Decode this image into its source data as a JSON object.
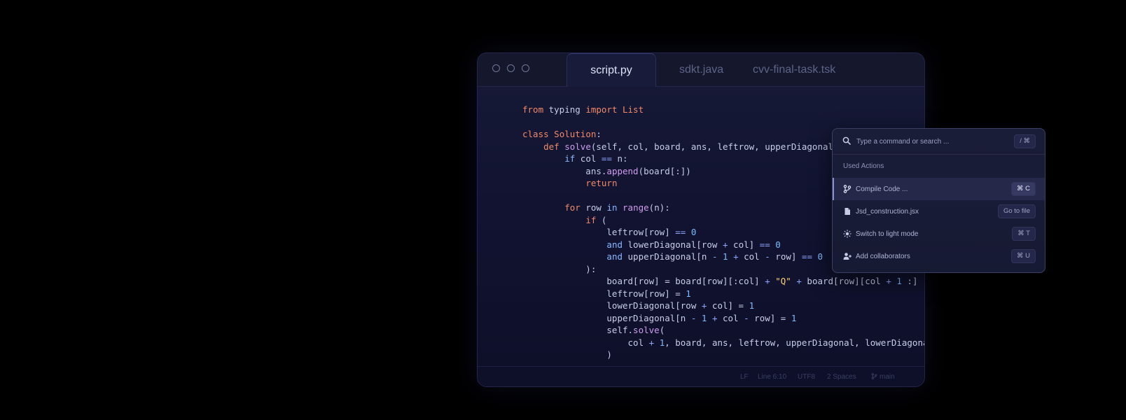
{
  "window": {
    "tabs": [
      {
        "label": "script.py",
        "active": true
      },
      {
        "label": "sdkt.java",
        "active": false
      },
      {
        "label": "cvv-final-task.tsk",
        "active": false
      }
    ]
  },
  "code_lines": [
    [
      [
        "kw",
        "from"
      ],
      [
        "t",
        " typing "
      ],
      [
        "kw",
        "import"
      ],
      [
        "kw",
        " List"
      ]
    ],
    [],
    [
      [
        "kw",
        "class"
      ],
      [
        "kw",
        " Solution"
      ],
      [
        "t",
        ":"
      ]
    ],
    [
      [
        "t",
        "    "
      ],
      [
        "kw",
        "def"
      ],
      [
        "t",
        " "
      ],
      [
        "fn",
        "solve"
      ],
      [
        "t",
        "(self, col, board, ans, leftrow, upperDiagonal, lo"
      ]
    ],
    [
      [
        "t",
        "        "
      ],
      [
        "kb",
        "if"
      ],
      [
        "t",
        " col "
      ],
      [
        "op",
        "=="
      ],
      [
        "t",
        " n:"
      ]
    ],
    [
      [
        "t",
        "            ans."
      ],
      [
        "fn",
        "append"
      ],
      [
        "t",
        "(board[:])"
      ]
    ],
    [
      [
        "t",
        "            "
      ],
      [
        "kw",
        "return"
      ]
    ],
    [],
    [
      [
        "t",
        "        "
      ],
      [
        "kw",
        "for"
      ],
      [
        "t",
        " row "
      ],
      [
        "kb",
        "in"
      ],
      [
        "t",
        " "
      ],
      [
        "fn",
        "range"
      ],
      [
        "t",
        "(n):"
      ]
    ],
    [
      [
        "t",
        "            "
      ],
      [
        "kw",
        "if"
      ],
      [
        "t",
        " ("
      ]
    ],
    [
      [
        "t",
        "                leftrow[row] "
      ],
      [
        "op",
        "=="
      ],
      [
        "t",
        " "
      ],
      [
        "nm",
        "0"
      ]
    ],
    [
      [
        "t",
        "                "
      ],
      [
        "kb",
        "and"
      ],
      [
        "t",
        " lowerDiagonal[row "
      ],
      [
        "op",
        "+"
      ],
      [
        "t",
        " col] "
      ],
      [
        "op",
        "=="
      ],
      [
        "t",
        " "
      ],
      [
        "nm",
        "0"
      ]
    ],
    [
      [
        "t",
        "                "
      ],
      [
        "kb",
        "and"
      ],
      [
        "t",
        " upperDiagonal[n "
      ],
      [
        "op",
        "-"
      ],
      [
        "t",
        " "
      ],
      [
        "nm",
        "1"
      ],
      [
        "t",
        " "
      ],
      [
        "op",
        "+"
      ],
      [
        "t",
        " col "
      ],
      [
        "op",
        "-"
      ],
      [
        "t",
        " row] "
      ],
      [
        "op",
        "=="
      ],
      [
        "t",
        " "
      ],
      [
        "nm",
        "0"
      ]
    ],
    [
      [
        "t",
        "            ):"
      ]
    ],
    [
      [
        "t",
        "                board[row] = board[row][:col] "
      ],
      [
        "op",
        "+"
      ],
      [
        "t",
        " "
      ],
      [
        "st",
        "\"Q\""
      ],
      [
        "t",
        " "
      ],
      [
        "op",
        "+"
      ],
      [
        "t",
        " board[row][col "
      ],
      [
        "op",
        "+"
      ],
      [
        "t",
        " "
      ],
      [
        "nm",
        "1"
      ],
      [
        "t",
        " :]"
      ]
    ],
    [
      [
        "t",
        "                leftrow[row] = "
      ],
      [
        "nm",
        "1"
      ]
    ],
    [
      [
        "t",
        "                lowerDiagonal[row "
      ],
      [
        "op",
        "+"
      ],
      [
        "t",
        " col] = "
      ],
      [
        "nm",
        "1"
      ]
    ],
    [
      [
        "t",
        "                upperDiagonal[n "
      ],
      [
        "op",
        "-"
      ],
      [
        "t",
        " "
      ],
      [
        "nm",
        "1"
      ],
      [
        "t",
        " "
      ],
      [
        "op",
        "+"
      ],
      [
        "t",
        " col "
      ],
      [
        "op",
        "-"
      ],
      [
        "t",
        " row] = "
      ],
      [
        "nm",
        "1"
      ]
    ],
    [
      [
        "t",
        "                self."
      ],
      [
        "fn",
        "solve"
      ],
      [
        "t",
        "("
      ]
    ],
    [
      [
        "t",
        "                    col "
      ],
      [
        "op",
        "+"
      ],
      [
        "t",
        " "
      ],
      [
        "nm",
        "1"
      ],
      [
        "t",
        ", board, ans, leftrow, upperDiagonal, lowerDiagonal"
      ]
    ],
    [
      [
        "t",
        "                )"
      ]
    ]
  ],
  "statusbar": {
    "eol": "LF",
    "position": "Line 6:10",
    "encoding": "UTF8",
    "indent": "2 Spaces",
    "branch": "main"
  },
  "palette": {
    "search_placeholder": "Type a command or search ...",
    "search_shortcut": "/ ⌘",
    "section_title": "Used Actions",
    "items": [
      {
        "label": "Compile Code ...",
        "shortcut": "⌘ C",
        "icon": "branch-icon",
        "selected": true
      },
      {
        "label": "Jsd_construction.jsx",
        "shortcut": "Go to file",
        "icon": "file-icon",
        "selected": false
      },
      {
        "label": "Switch to light mode",
        "shortcut": "⌘ T",
        "icon": "sun-icon",
        "selected": false
      },
      {
        "label": "Add collaborators",
        "shortcut": "⌘ U",
        "icon": "add-user-icon",
        "selected": false
      }
    ]
  },
  "colors": {
    "keyword": "#f08a6a",
    "builtin_keyword": "#8ab8ff",
    "function": "#cf9df0",
    "number": "#7fbcff",
    "string": "#ffd27a",
    "editor_bg": "#111331",
    "page_bg": "#000000"
  }
}
